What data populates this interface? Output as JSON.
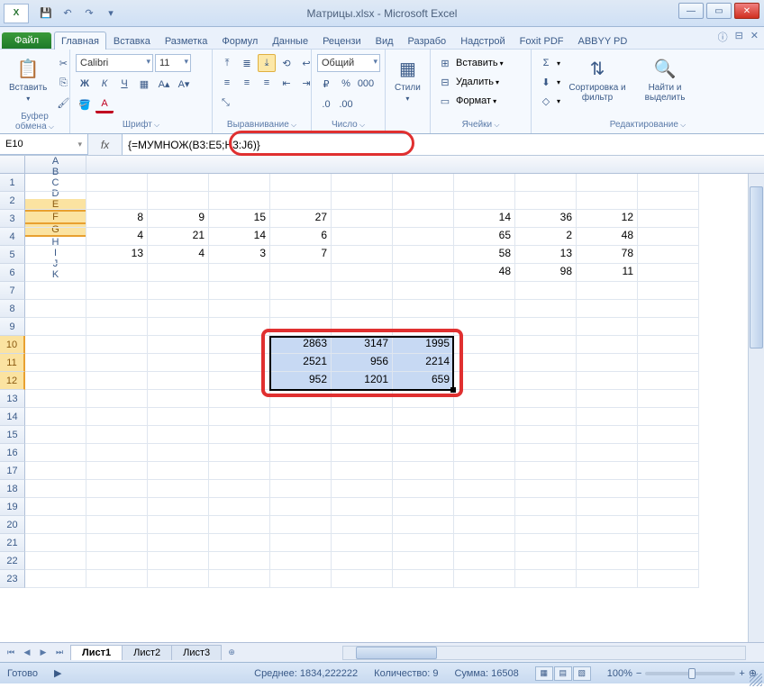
{
  "title": "Матрицы.xlsx - Microsoft Excel",
  "qat": {
    "save": "💾",
    "undo": "↶",
    "redo": "↷"
  },
  "ribbon": {
    "file": "Файл",
    "tabs": [
      "Главная",
      "Вставка",
      "Разметка",
      "Формул",
      "Данные",
      "Рецензи",
      "Вид",
      "Разрабо",
      "Надстрой",
      "Foxit PDF",
      "ABBYY PD"
    ],
    "active_tab_index": 0,
    "help_icons": [
      "ⓘ",
      "⊟",
      "✕"
    ],
    "groups": {
      "clipboard": {
        "label": "Буфер обмена",
        "paste": "Вставить",
        "cut": "✂",
        "copy": "⎘",
        "painter": "🖌"
      },
      "font": {
        "label": "Шрифт",
        "name": "Calibri",
        "size": "11",
        "bold": "Ж",
        "italic": "К",
        "underline": "Ч",
        "border": "▦",
        "fill": "🪣",
        "color": "A"
      },
      "align": {
        "label": "Выравнивание",
        "top": "⤒",
        "mid": "≣",
        "bot": "⤓",
        "wrap": "↩",
        "left": "≡",
        "center": "≡",
        "right": "≡",
        "merge": "⤡",
        "indent_dec": "⇤",
        "indent_inc": "⇥",
        "orient": "⟲"
      },
      "number": {
        "label": "Число",
        "format": "Общий",
        "currency": "%",
        "percent": "%",
        "comma": ",",
        "dec_inc": ".0",
        "dec_dec": ".00"
      },
      "styles": {
        "label": "Стили",
        "btn": "Стили",
        "icon": "▦"
      },
      "cells": {
        "label": "Ячейки",
        "insert": "Вставить",
        "delete": "Удалить",
        "format": "Формат",
        "ins_icon": "⊞",
        "del_icon": "⊟",
        "fmt_icon": "▭"
      },
      "editing": {
        "label": "Редактирование",
        "sum": "Σ",
        "fill": "⬇",
        "clear": "◇",
        "sort": "Сортировка и фильтр",
        "find": "Найти и выделить",
        "sort_icon": "⇅",
        "find_icon": "🔍"
      }
    }
  },
  "namebox": "E10",
  "formula": "{=МУМНОЖ(B3:E5;H3:J6)}",
  "columns": [
    "A",
    "B",
    "C",
    "D",
    "E",
    "F",
    "G",
    "H",
    "I",
    "J",
    "K"
  ],
  "selected_cols": [
    "E",
    "F",
    "G"
  ],
  "rows": 23,
  "selected_rows": [
    10,
    11,
    12
  ],
  "cells": {
    "B3": "8",
    "C3": "9",
    "D3": "15",
    "E3": "27",
    "H3": "14",
    "I3": "36",
    "J3": "12",
    "B4": "4",
    "C4": "21",
    "D4": "14",
    "E4": "6",
    "H4": "65",
    "I4": "2",
    "J4": "48",
    "B5": "13",
    "C5": "4",
    "D5": "3",
    "E5": "7",
    "H5": "58",
    "I5": "13",
    "J5": "78",
    "H6": "48",
    "I6": "98",
    "J6": "11",
    "E10": "2863",
    "F10": "3147",
    "G10": "1995",
    "E11": "2521",
    "F11": "956",
    "G11": "2214",
    "E12": "952",
    "F12": "1201",
    "G12": "659"
  },
  "sheets": {
    "tabs": [
      "Лист1",
      "Лист2",
      "Лист3"
    ],
    "active": 0,
    "nav": [
      "⏮",
      "◀",
      "▶",
      "⏭"
    ],
    "new": "⊕"
  },
  "status": {
    "ready": "Готово",
    "avg_label": "Среднее:",
    "avg": "1834,222222",
    "count_label": "Количество:",
    "count": "9",
    "sum_label": "Сумма:",
    "sum": "16508",
    "zoom": "100%",
    "zoom_minus": "−",
    "zoom_plus": "+",
    "zoom_expand": "⊕"
  }
}
